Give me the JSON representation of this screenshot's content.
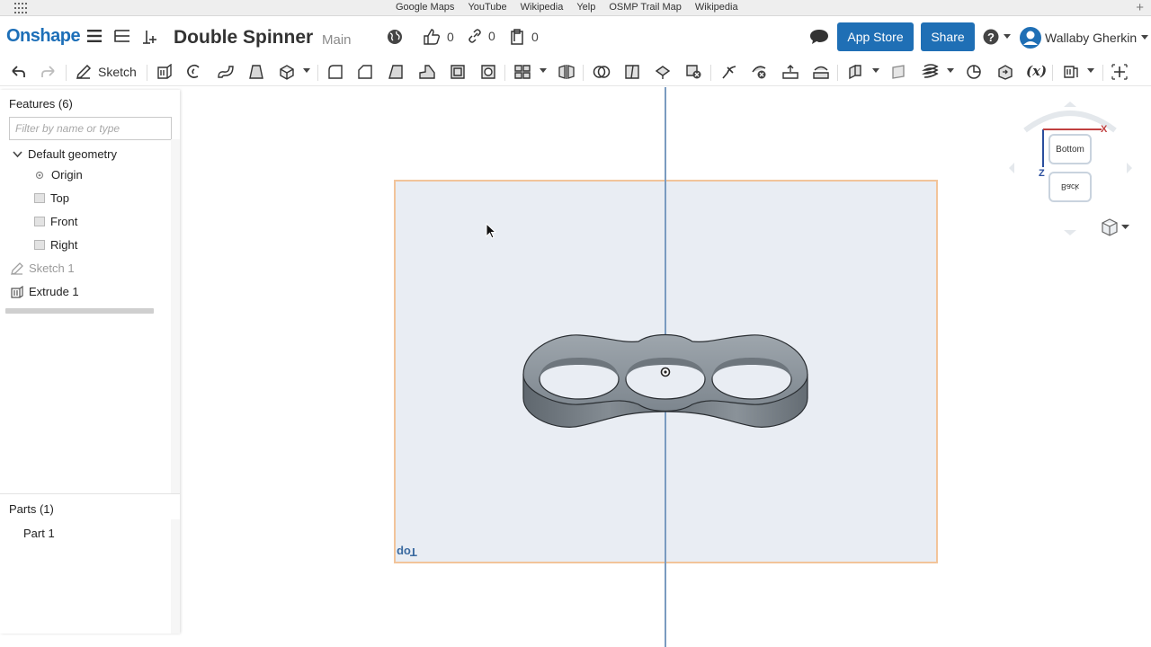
{
  "bookmarks": [
    "Google Maps",
    "YouTube",
    "Wikipedia",
    "Yelp",
    "OSMP Trail Map",
    "Wikipedia"
  ],
  "header": {
    "logo": "Onshape",
    "doc_title": "Double Spinner",
    "branch": "Main",
    "likes": "0",
    "links": "0",
    "copies": "0",
    "app_store_label": "App Store",
    "share_label": "Share",
    "user_name": "Wallaby Gherkin"
  },
  "toolbar": {
    "sketch_label": "Sketch",
    "variable_label": "(x)",
    "icons": [
      "undo-icon",
      "redo-icon",
      "sketch-icon",
      "extrude-icon",
      "revolve-icon",
      "sweep-icon",
      "loft-icon",
      "thicken-icon",
      "fillet-icon",
      "chamfer-icon",
      "draft-icon",
      "rib-icon",
      "shell-icon",
      "hole-icon",
      "pattern-icon",
      "mirror-icon",
      "boolean-icon",
      "split-icon",
      "transform-icon",
      "delete-part-icon",
      "modify-fillet-icon",
      "delete-face-icon",
      "move-face-icon",
      "replace-face-icon",
      "plane-icon",
      "helix-icon",
      "mate-connector-icon",
      "curve-icon",
      "measure-icon",
      "import-icon",
      "variable-icon",
      "part-studio-icon",
      "add-icon"
    ]
  },
  "features_panel": {
    "title": "Features (6)",
    "filter_placeholder": "Filter by name or type",
    "items": [
      {
        "label": "Default geometry",
        "icon": "chevron-down-icon"
      },
      {
        "label": "Origin",
        "icon": "origin-icon"
      },
      {
        "label": "Top",
        "icon": "plane-icon"
      },
      {
        "label": "Front",
        "icon": "plane-icon"
      },
      {
        "label": "Right",
        "icon": "plane-icon"
      },
      {
        "label": "Sketch 1",
        "icon": "sketch-icon"
      },
      {
        "label": "Extrude 1",
        "icon": "extrude-icon"
      }
    ]
  },
  "parts_panel": {
    "title": "Parts (1)",
    "items": [
      {
        "label": "Part 1"
      }
    ]
  },
  "viewport": {
    "plane_label": "Top",
    "viewcube": {
      "front_face": "Bottom",
      "back_face": "Back",
      "axis_x": "X",
      "axis_z": "Z"
    }
  },
  "colors": {
    "brand": "#1d6fb8",
    "button_blue": "#1f6fb5",
    "plane_fill": "#e9edf3",
    "plane_border": "#f2c49a",
    "axis_blue": "#7a9bc0"
  }
}
